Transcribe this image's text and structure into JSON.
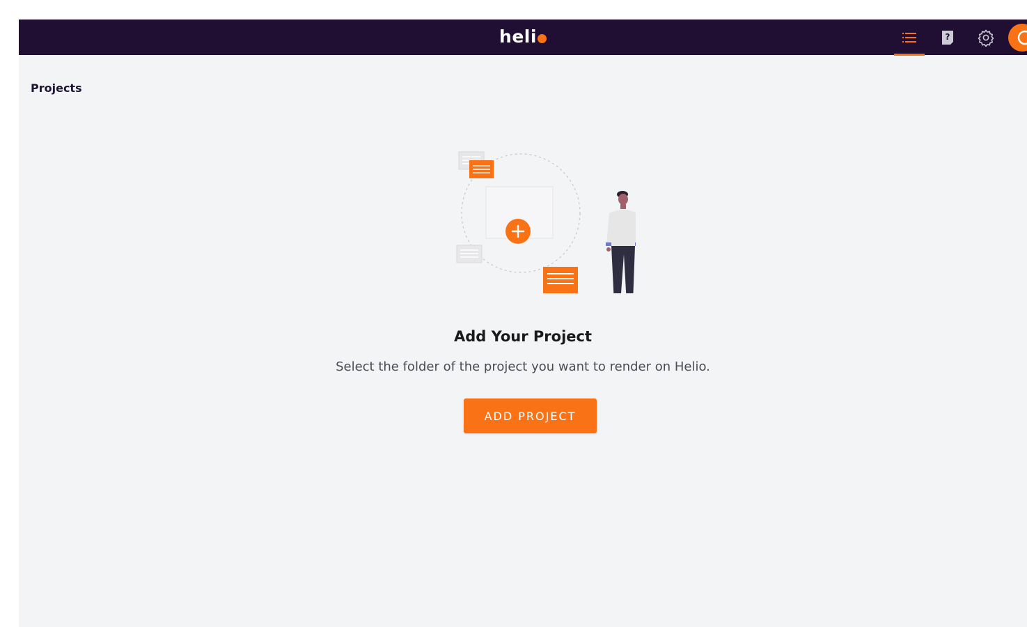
{
  "app": {
    "logo_text": "heli",
    "accent_color": "#f97316",
    "topbar_color": "#200f33"
  },
  "topbar": {
    "icons": [
      {
        "name": "list-icon",
        "active": true
      },
      {
        "name": "help-icon",
        "active": false
      },
      {
        "name": "gear-icon",
        "active": false
      },
      {
        "name": "user-avatar-icon",
        "active": false
      }
    ]
  },
  "page": {
    "title": "Projects"
  },
  "empty_state": {
    "title": "Add Your Project",
    "description": "Select the folder of the project you want to render on Helio.",
    "button_label": "ADD PROJECT",
    "illustration": "person-standing-beside-add-project-circle"
  }
}
